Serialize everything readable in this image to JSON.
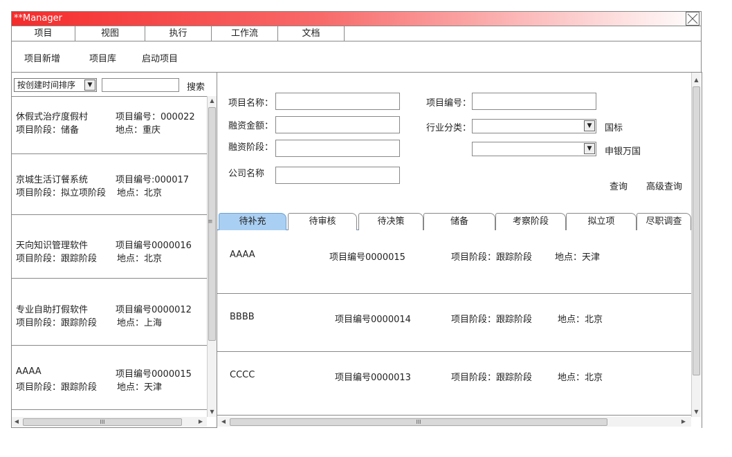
{
  "window": {
    "title": "**Manager"
  },
  "menu": [
    "项目",
    "视图",
    "执行",
    "工作流",
    "文档"
  ],
  "toolbar": [
    "项目新增",
    "项目库",
    "启动项目"
  ],
  "left": {
    "sort_value": "按创建时间排序",
    "search_value": "",
    "search_label": "搜索",
    "items": [
      {
        "name": "休假式治疗度假村",
        "code": "项目编号：000022",
        "stage": "项目阶段：储备",
        "location": "地点：重庆"
      },
      {
        "name": "京城生活订餐系统",
        "code": "项目编号:000017",
        "stage": "项目阶段：拟立项阶段",
        "location": "地点：北京"
      },
      {
        "name": "天向知识管理软件",
        "code": "项目编号0000016",
        "stage": "项目阶段：跟踪阶段",
        "location": "地点：北京"
      },
      {
        "name": "专业自助打假软件",
        "code": "项目编号0000012",
        "stage": "项目阶段：跟踪阶段",
        "location": "地点：上海"
      },
      {
        "name": "AAAA",
        "code": "项目编号0000015",
        "stage": "项目阶段：跟踪阶段",
        "location": "地点：天津"
      }
    ],
    "hscroll_grip": "III"
  },
  "form": {
    "project_name_label": "项目名称：",
    "project_code_label": "项目编号：",
    "amount_label": "融资金额：",
    "industry_label": "行业分类：",
    "industry_value": "",
    "industry_std": "国标",
    "stage_label": "融资阶段：",
    "stage_value": "",
    "stage_std": "申银万国",
    "company_label": "公司名称",
    "query_label": "查询",
    "advanced_query_label": "高级查询"
  },
  "tabs": [
    "待补充",
    "待审核",
    "待决策",
    "储备",
    "考察阶段",
    "拟立项",
    "尽职调查"
  ],
  "active_tab": "待补充",
  "rows": [
    {
      "name": "AAAA",
      "code": "项目编号0000015",
      "stage": "项目阶段：跟踪阶段",
      "location": "地点：天津"
    },
    {
      "name": "BBBB",
      "code": "项目编号0000014",
      "stage": "项目阶段：跟踪阶段",
      "location": "地点：北京"
    },
    {
      "name": "CCCC",
      "code": "项目编号0000013",
      "stage": "项目阶段：跟踪阶段",
      "location": "地点：北京"
    }
  ],
  "right_hscroll_grip": "III",
  "colors": {
    "title_red": "#f52b2b",
    "active_tab": "#a9cff2"
  }
}
